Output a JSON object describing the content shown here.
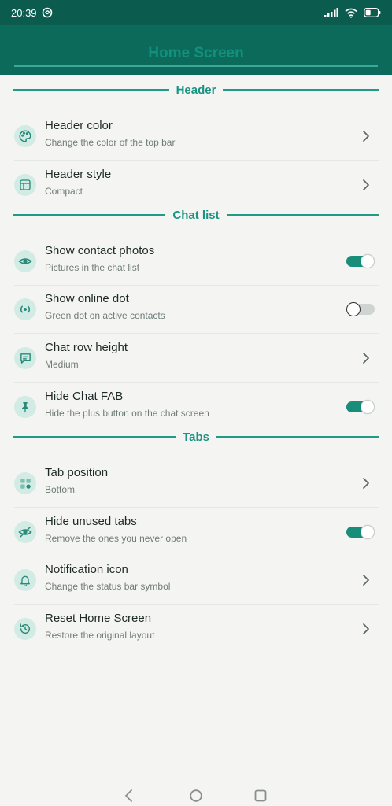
{
  "status_bar": {
    "time": "20:39"
  },
  "app_bar": {
    "title": "Home Screen"
  },
  "sections": {
    "header": "Header",
    "chat_list": "Chat list",
    "tabs": "Tabs"
  },
  "rows": {
    "header_color": {
      "title": "Header color",
      "subtitle": "Change the color of the top bar"
    },
    "header_style": {
      "title": "Header style",
      "subtitle": "Compact"
    },
    "contact_photos": {
      "title": "Show contact photos",
      "subtitle": "Pictures in the chat list",
      "enabled": true
    },
    "online_dot": {
      "title": "Show online dot",
      "subtitle": "Green dot on active contacts",
      "enabled": false
    },
    "row_height": {
      "title": "Chat row height",
      "subtitle": "Medium"
    },
    "hide_fab": {
      "title": "Hide Chat FAB",
      "subtitle": "Hide the plus button on the chat screen",
      "enabled": true
    },
    "tab_position": {
      "title": "Tab position",
      "subtitle": "Bottom"
    },
    "hide_unused_tabs": {
      "title": "Hide unused tabs",
      "subtitle": "Remove the ones you never open",
      "enabled": true
    },
    "notification_icon": {
      "title": "Notification icon",
      "subtitle": "Change the status bar symbol"
    },
    "reset_home": {
      "title": "Reset Home Screen",
      "subtitle": "Restore the original layout"
    }
  },
  "icons": {
    "header_color": "palette-icon",
    "header_style": "layout-icon",
    "contact_photos": "eye-icon",
    "online_dot": "online-dot-icon",
    "row_height": "message-icon",
    "hide_fab": "pin-icon",
    "tab_position": "grid-icon",
    "hide_unused_tabs": "eye-off-icon",
    "notification_icon": "bell-icon",
    "reset_home": "reset-icon"
  },
  "colors": {
    "primary": "#0c6a5a",
    "status_bar": "#0b5b4e",
    "accent": "#1a9482",
    "icon_background": "#d2ebe4",
    "background": "#f4f5f3"
  }
}
